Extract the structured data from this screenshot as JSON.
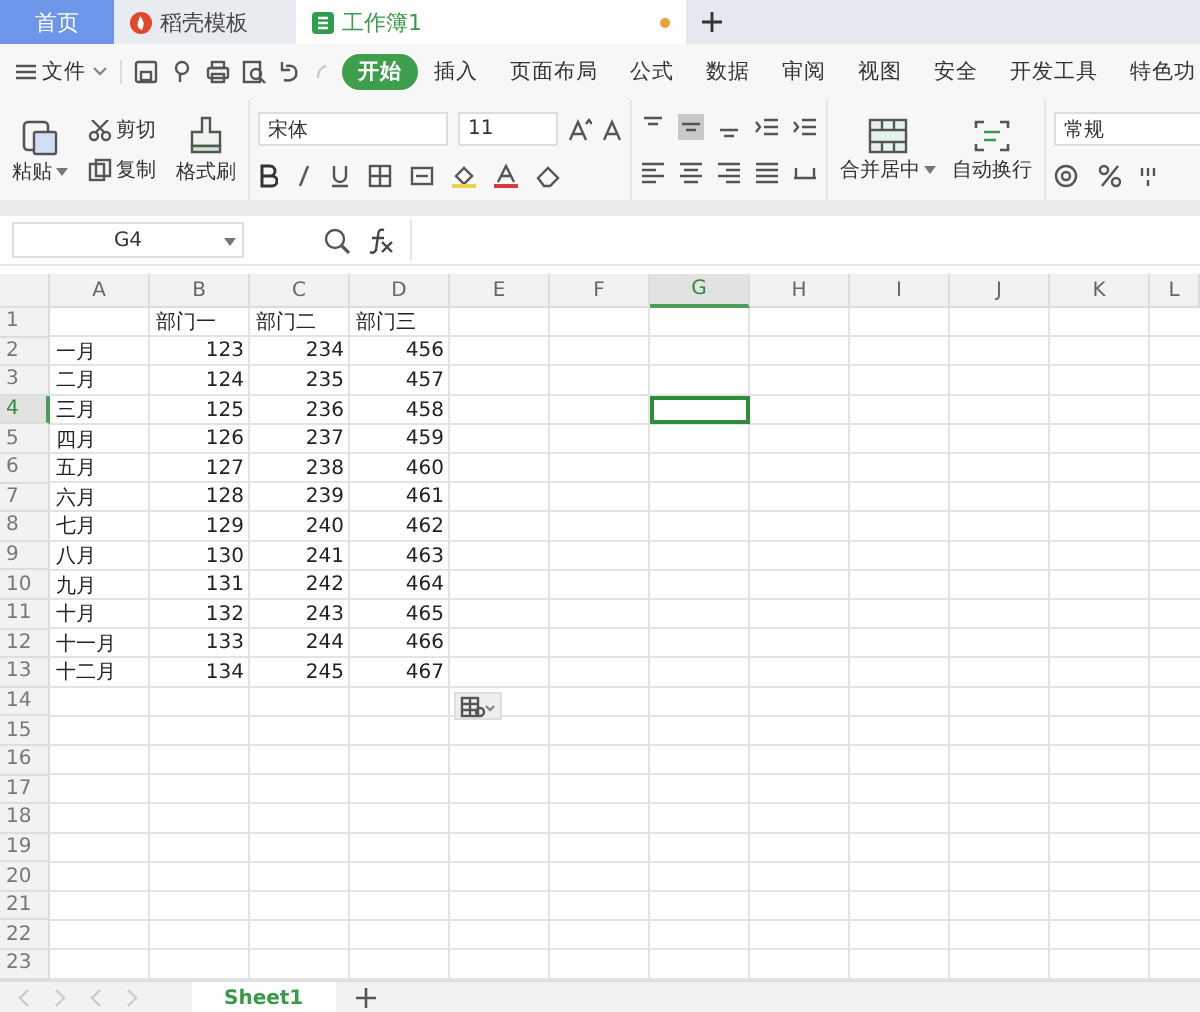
{
  "tabs": [
    {
      "label": "首页",
      "kind": "home",
      "selected": false
    },
    {
      "label": "稻壳模板",
      "kind": "template",
      "selected": false
    },
    {
      "label": "工作簿1",
      "kind": "sheet",
      "selected": true,
      "unsaved": true
    }
  ],
  "menu": {
    "file": "文件",
    "items": [
      {
        "label": "开始",
        "selected": true
      },
      {
        "label": "插入",
        "selected": false
      },
      {
        "label": "页面布局",
        "selected": false
      },
      {
        "label": "公式",
        "selected": false
      },
      {
        "label": "数据",
        "selected": false
      },
      {
        "label": "审阅",
        "selected": false
      },
      {
        "label": "视图",
        "selected": false
      },
      {
        "label": "安全",
        "selected": false
      },
      {
        "label": "开发工具",
        "selected": false
      },
      {
        "label": "特色功",
        "selected": false
      }
    ]
  },
  "ribbon": {
    "paste": "粘贴",
    "cut": "剪切",
    "copy": "复制",
    "format_painter": "格式刷",
    "font": "宋体",
    "font_size": "11",
    "merge": "合并居中",
    "wrap": "自动换行",
    "number_format": "常规"
  },
  "formula_bar": {
    "name_box": "G4"
  },
  "columns": [
    {
      "label": "A",
      "selected": false
    },
    {
      "label": "B",
      "selected": false
    },
    {
      "label": "C",
      "selected": false
    },
    {
      "label": "D",
      "selected": false
    },
    {
      "label": "E",
      "selected": false
    },
    {
      "label": "F",
      "selected": false
    },
    {
      "label": "G",
      "selected": true
    },
    {
      "label": "H",
      "selected": false
    },
    {
      "label": "I",
      "selected": false
    },
    {
      "label": "J",
      "selected": false
    },
    {
      "label": "K",
      "selected": false
    },
    {
      "label": "L",
      "selected": false
    }
  ],
  "rows": [
    {
      "number": "1",
      "selected": false,
      "headings": [
        "部门一",
        "部门二",
        "部门三"
      ]
    },
    {
      "number": "2",
      "selected": false,
      "month": "一月",
      "values": [
        "123",
        "234",
        "456"
      ]
    },
    {
      "number": "3",
      "selected": false,
      "month": "二月",
      "values": [
        "124",
        "235",
        "457"
      ]
    },
    {
      "number": "4",
      "selected": true,
      "month": "三月",
      "values": [
        "125",
        "236",
        "458"
      ]
    },
    {
      "number": "5",
      "selected": false,
      "month": "四月",
      "values": [
        "126",
        "237",
        "459"
      ]
    },
    {
      "number": "6",
      "selected": false,
      "month": "五月",
      "values": [
        "127",
        "238",
        "460"
      ]
    },
    {
      "number": "7",
      "selected": false,
      "month": "六月",
      "values": [
        "128",
        "239",
        "461"
      ]
    },
    {
      "number": "8",
      "selected": false,
      "month": "七月",
      "values": [
        "129",
        "240",
        "462"
      ]
    },
    {
      "number": "9",
      "selected": false,
      "month": "八月",
      "values": [
        "130",
        "241",
        "463"
      ]
    },
    {
      "number": "10",
      "selected": false,
      "month": "九月",
      "values": [
        "131",
        "242",
        "464"
      ]
    },
    {
      "number": "11",
      "selected": false,
      "month": "十月",
      "values": [
        "132",
        "243",
        "465"
      ]
    },
    {
      "number": "12",
      "selected": false,
      "month": "十一月",
      "values": [
        "133",
        "244",
        "466"
      ]
    },
    {
      "number": "13",
      "selected": false,
      "month": "十二月",
      "values": [
        "134",
        "245",
        "467"
      ]
    },
    {
      "number": "14",
      "selected": false
    },
    {
      "number": "15",
      "selected": false
    },
    {
      "number": "16",
      "selected": false
    },
    {
      "number": "17",
      "selected": false
    },
    {
      "number": "18",
      "selected": false
    },
    {
      "number": "19",
      "selected": false
    },
    {
      "number": "20",
      "selected": false
    },
    {
      "number": "21",
      "selected": false
    },
    {
      "number": "22",
      "selected": false
    },
    {
      "number": "23",
      "selected": false
    }
  ],
  "sheets": [
    {
      "label": "Sheet1",
      "selected": true
    }
  ]
}
